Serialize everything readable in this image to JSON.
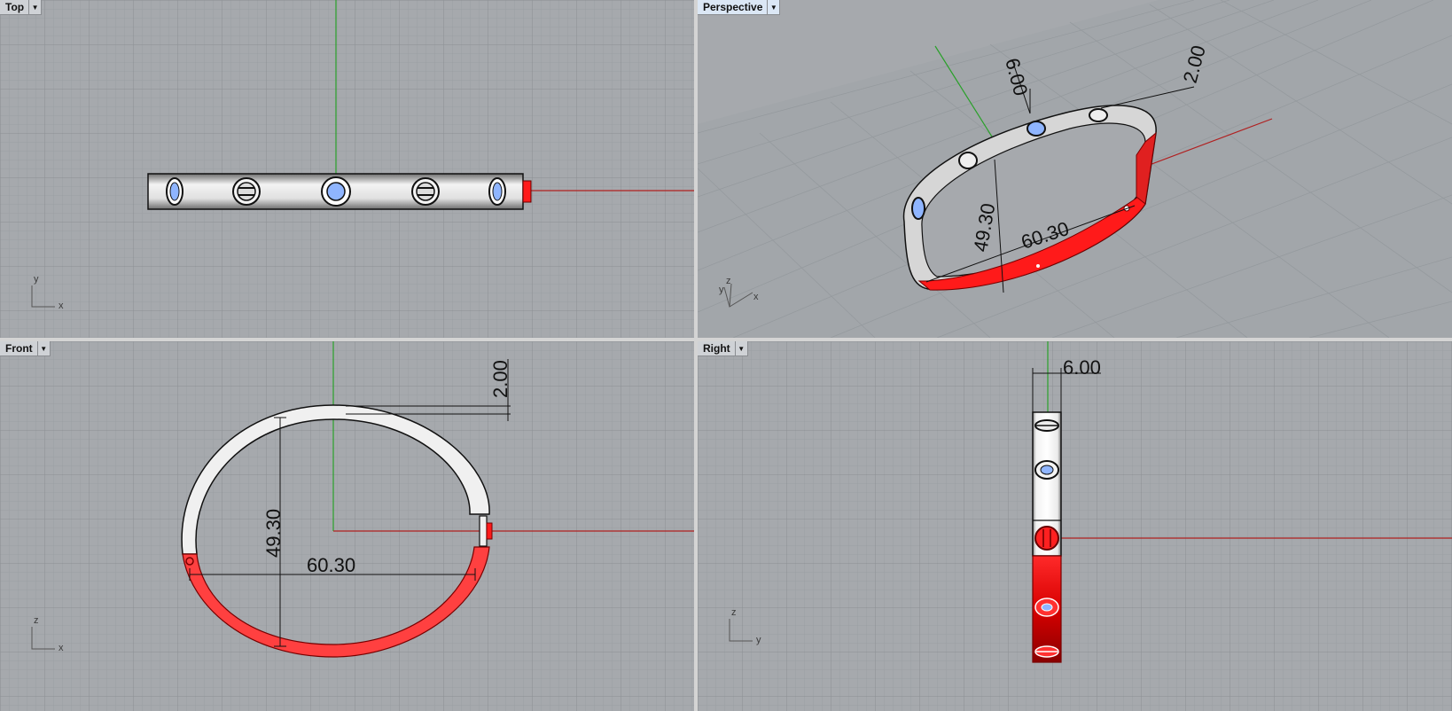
{
  "viewports": {
    "top": {
      "title": "Top",
      "axis_x": "x",
      "axis_y": "y"
    },
    "perspective": {
      "title": "Perspective",
      "axis_x": "x",
      "axis_y": "y",
      "axis_z": "z",
      "dim_thickness": "2.00",
      "dim_height": "49.30",
      "dim_width": "60.30",
      "dim_top": "6.00"
    },
    "front": {
      "title": "Front",
      "axis_x": "x",
      "axis_z": "z",
      "dim_thickness": "2.00",
      "dim_height": "49.30",
      "dim_width": "60.30"
    },
    "right": {
      "title": "Right",
      "axis_y": "y",
      "axis_z": "z",
      "dim_width": "6.00"
    }
  },
  "colors": {
    "viewport_bg": "#a6a9ad",
    "grid_minor": "#9a9da1",
    "grid_major": "#8b8e92",
    "axis_x": "#b02020",
    "axis_y": "#20a020",
    "selection": "#ff1a1a",
    "metal": "#e4e4e4",
    "stone": "#8fb5ff"
  }
}
